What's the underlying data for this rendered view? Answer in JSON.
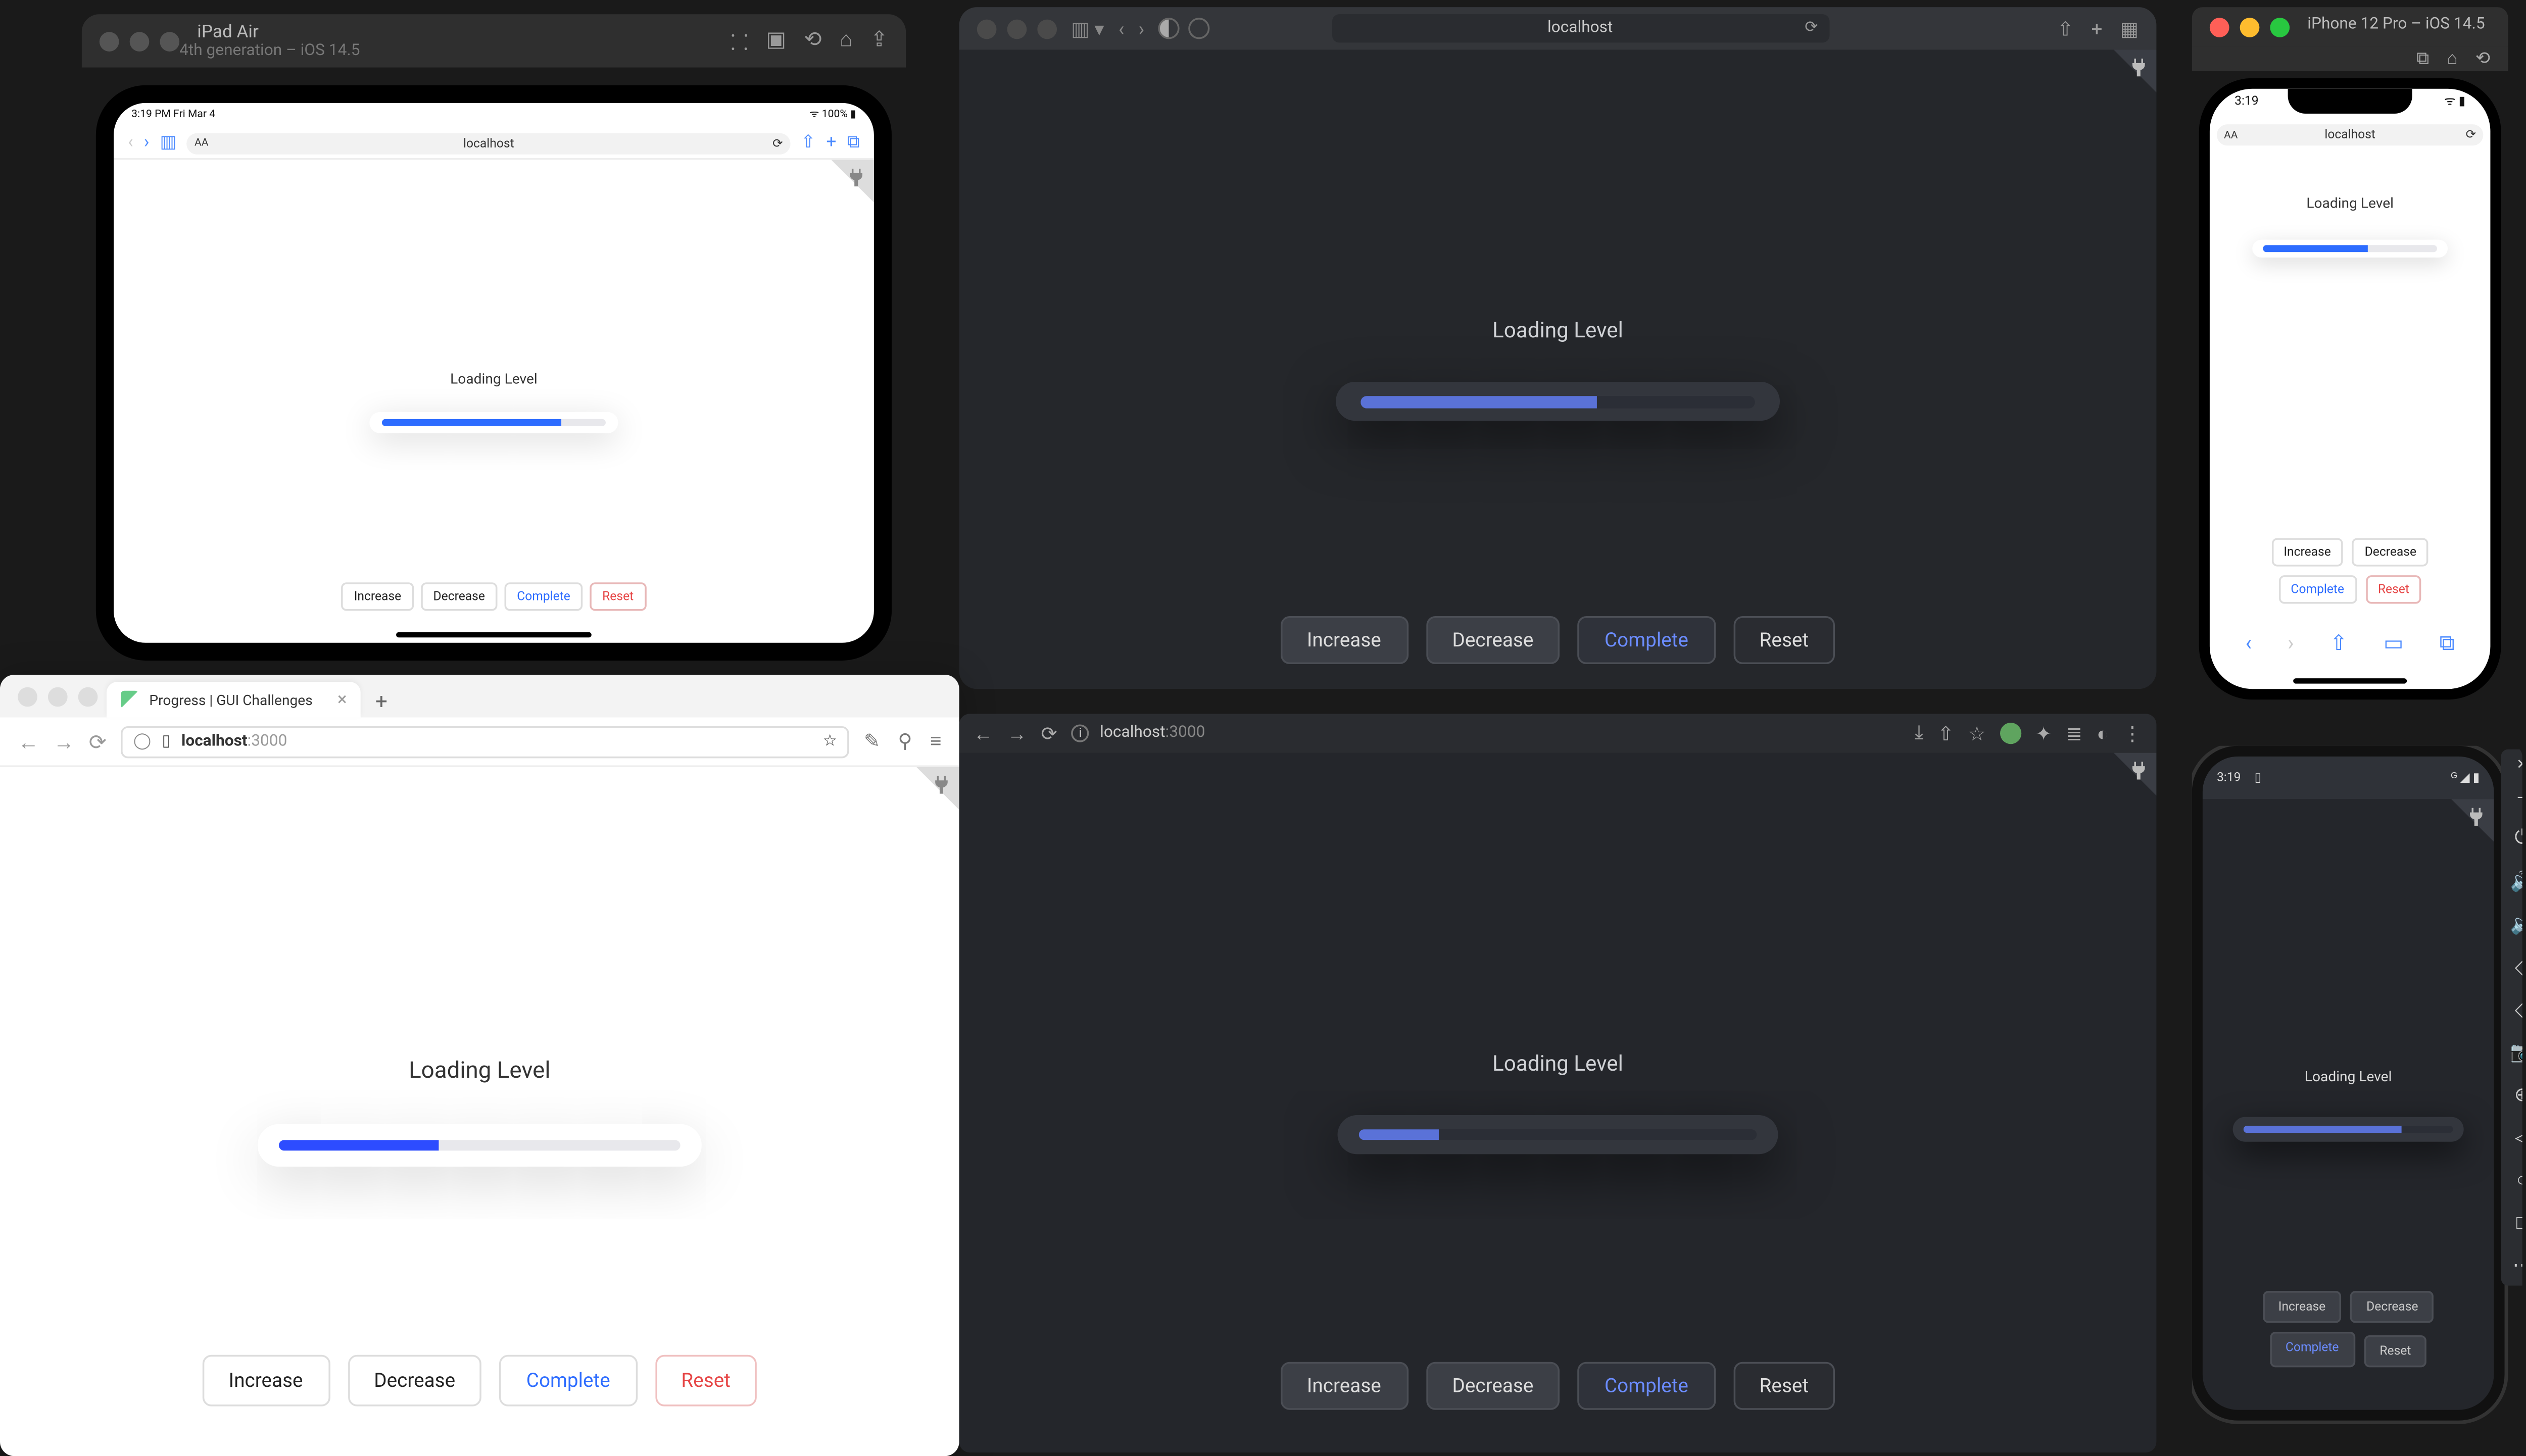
{
  "demo": {
    "loading_label": "Loading Level",
    "buttons": {
      "increase": "Increase",
      "decrease": "Decrease",
      "complete": "Complete",
      "reset": "Reset"
    }
  },
  "ipad_simulator": {
    "title": "iPad Air",
    "subtitle": "4th generation – iOS 14.5",
    "status_left": "3:19 PM  Fri Mar 4",
    "status_right": "100%",
    "url": "localhost",
    "progress_pct": 80
  },
  "safari": {
    "url": "localhost",
    "progress_pct": 60
  },
  "iphone_simulator": {
    "title": "iPhone 12 Pro – iOS 14.5",
    "time": "3:19",
    "url": "localhost",
    "progress_pct": 60
  },
  "firefox": {
    "tab_title": "Progress | GUI Challenges",
    "host": "localhost",
    "port": ":3000",
    "progress_pct": 40
  },
  "chrome": {
    "host": "localhost",
    "port": ":3000",
    "progress_pct": 20
  },
  "android": {
    "time": "3:19",
    "progress_pct": 75
  }
}
